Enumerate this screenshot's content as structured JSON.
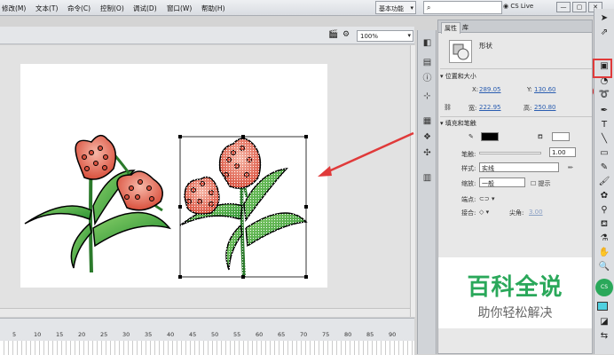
{
  "menu": [
    "修改(M)",
    "文本(T)",
    "命令(C)",
    "控制(O)",
    "调试(D)",
    "窗口(W)",
    "帮助(H)"
  ],
  "topbar": {
    "workspace": "基本功能",
    "search_placeholder": "",
    "cslive": "CS Live",
    "win": [
      "—",
      "▢",
      "✕"
    ]
  },
  "zoom": "100%",
  "props": {
    "tabs": [
      "属性",
      "库"
    ],
    "shape_label": "形状",
    "section_pos": "位置和大小",
    "x_label": "X:",
    "x_value": "289.05",
    "y_label": "Y:",
    "y_value": "130.60",
    "w_label": "宽:",
    "w_value": "222.95",
    "h_label": "高:",
    "h_value": "250.80",
    "section_fill": "填充和笔触",
    "stroke_label": "笔触:",
    "stroke_value": "1.00",
    "style_label": "样式:",
    "style_value": "实线",
    "scale_label": "缩放:",
    "scale_value": "一般",
    "hint_label": "提示",
    "cap_label": "端点:",
    "join_label": "接合:",
    "miter_label": "尖角:",
    "miter_value": "3.00"
  },
  "timeline_ticks": [
    "5",
    "10",
    "15",
    "20",
    "25",
    "30",
    "35",
    "40",
    "45",
    "50",
    "55",
    "60",
    "65",
    "70",
    "75",
    "80",
    "85",
    "90"
  ],
  "watermark": {
    "title": "百科全说",
    "subtitle": "助你轻松解决"
  },
  "colors": {
    "accent_red": "#e03a3a",
    "watermark_green": "#2aa85a"
  }
}
